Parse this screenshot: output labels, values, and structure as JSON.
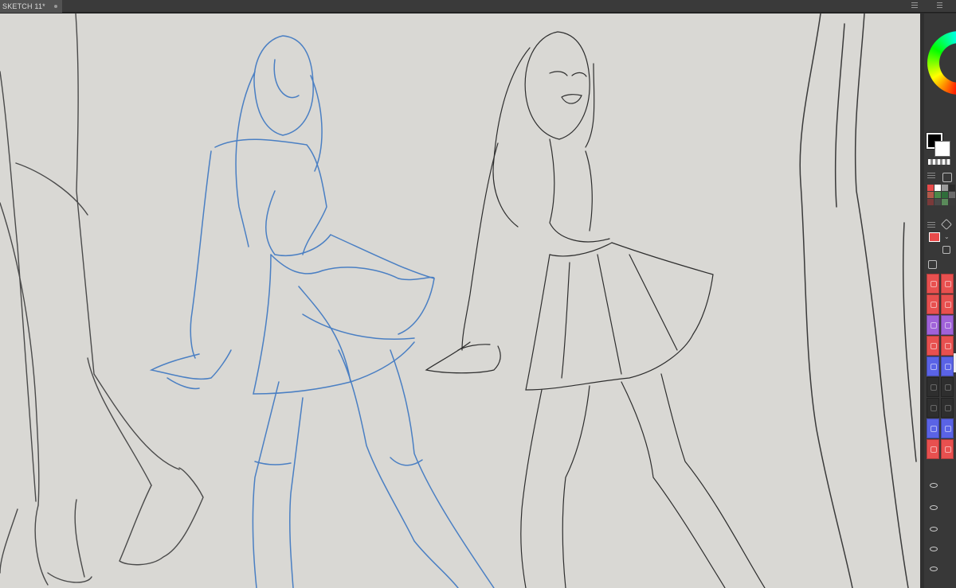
{
  "document": {
    "tab_title": "SKETCH 11*"
  },
  "colors": {
    "canvas_bg": "#d9d8d4",
    "rough_sketch": "#4a7fc3",
    "line_art": "#2e2e2e",
    "layer_red": "#e8504f",
    "layer_purple": "#a062d9",
    "layer_blue": "#5a63e6",
    "active_color": "#e84a4a",
    "foreground_color": "#000000",
    "background_color": "#ffffff"
  },
  "layers": [
    {
      "color": "red",
      "visible": false
    },
    {
      "color": "red",
      "visible": false
    },
    {
      "color": "purple",
      "visible": false
    },
    {
      "color": "red",
      "visible": true,
      "active": true
    },
    {
      "color": "blue",
      "visible": false
    },
    {
      "color": "empty",
      "visible": false
    },
    {
      "color": "empty",
      "visible": false
    },
    {
      "color": "blue",
      "visible": false
    },
    {
      "color": "red",
      "visible": false
    }
  ]
}
